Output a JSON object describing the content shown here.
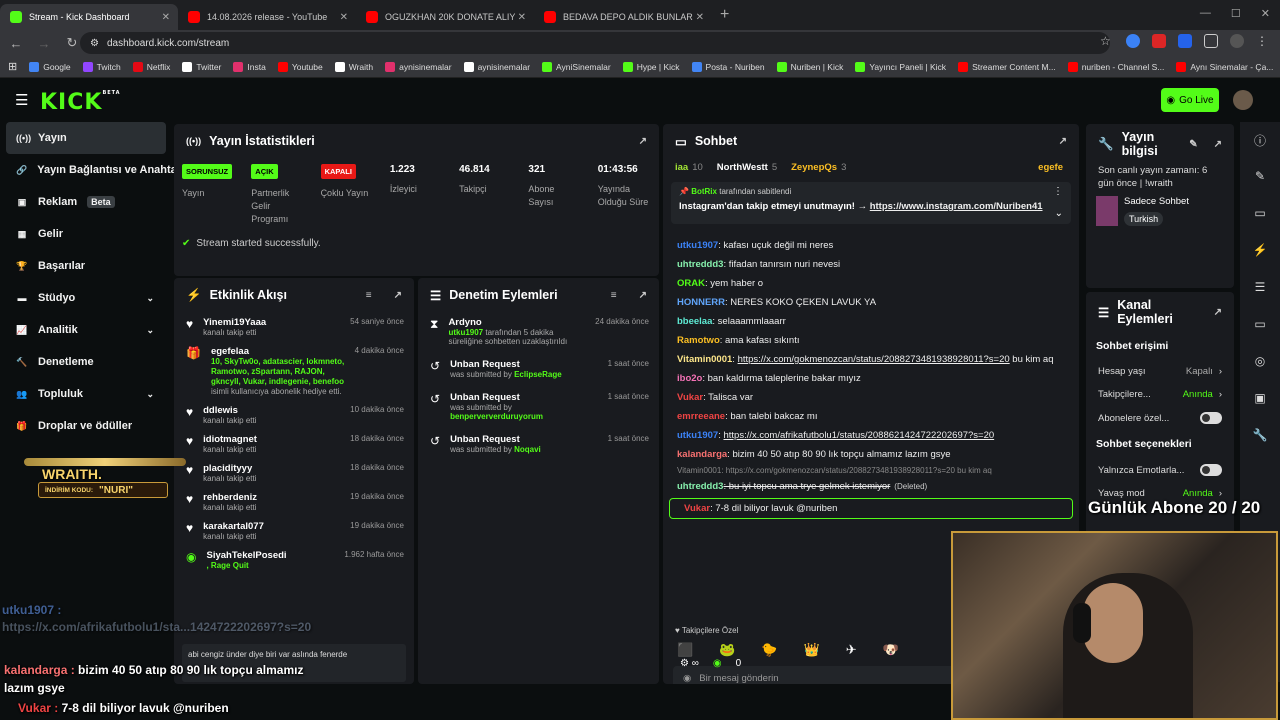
{
  "browser": {
    "tabs": [
      {
        "title": "Stream - Kick Dashboard",
        "color": "#53fc18",
        "active": true
      },
      {
        "title": "14.08.2026 release - YouTube",
        "color": "#ff0000"
      },
      {
        "title": "OGUZKHAN 20K DONATE ALIY",
        "color": "#ff0000"
      },
      {
        "title": "BEDAVA DEPO ALDIK BUNLAR",
        "color": "#ff0000"
      }
    ],
    "url": "dashboard.kick.com/stream",
    "bookmarks": [
      "Google",
      "Twitch",
      "Netflix",
      "Twitter",
      "Insta",
      "Youtube",
      "Wraith",
      "aynisinemalar",
      "aynisinemalar",
      "AyniSinemalar",
      "Hype | Kick",
      "Posta - Nuriben",
      "Nuriben | Kick",
      "Yayıncı Paneli | Kick",
      "Streamer Content M...",
      "nuriben - Channel S...",
      "Aynı Sinemalar - Ça..."
    ]
  },
  "kick": {
    "logo": "KICK",
    "logo_sup": "BETA",
    "golive": "Go Live",
    "sidebar": [
      {
        "label": "Yayın",
        "icon": "broadcast-icon",
        "glyph": "((•))",
        "active": true
      },
      {
        "label": "Yayın Bağlantısı ve Anahtarı",
        "icon": "link-icon",
        "glyph": "🔗"
      },
      {
        "label": "Reklam",
        "icon": "ad-icon",
        "glyph": "▣",
        "badge": "Beta"
      },
      {
        "label": "Gelir",
        "icon": "revenue-icon",
        "glyph": "▦"
      },
      {
        "label": "Başarılar",
        "icon": "trophy-icon",
        "glyph": "🏆"
      },
      {
        "label": "Stüdyo",
        "icon": "studio-icon",
        "glyph": "▬",
        "chev": true
      },
      {
        "label": "Analitik",
        "icon": "analytics-icon",
        "glyph": "📈",
        "chev": true
      },
      {
        "label": "Denetleme",
        "icon": "hammer-icon",
        "glyph": "🔨"
      },
      {
        "label": "Topluluk",
        "icon": "community-icon",
        "glyph": "👥",
        "chev": true
      },
      {
        "label": "Droplar ve ödüller",
        "icon": "gift-icon",
        "glyph": "🎁"
      }
    ],
    "stats": {
      "title": "Yayın İstatistikleri",
      "items": [
        {
          "pill": "SORUNSUZ",
          "pill_color": "#53fc18",
          "pill_text": "#000",
          "label": "Yayın"
        },
        {
          "pill": "AÇIK",
          "pill_color": "#53fc18",
          "pill_text": "#000",
          "label": "Partnerlik Gelir Programı"
        },
        {
          "pill": "KAPALI",
          "pill_color": "#e91916",
          "pill_text": "#fff",
          "label": "Çoklu Yayın"
        },
        {
          "value": "1.223",
          "label": "İzleyici"
        },
        {
          "value": "46.814",
          "label": "Takipçi"
        },
        {
          "value": "321",
          "label": "Abone Sayısı"
        },
        {
          "value": "01:43:56",
          "label": "Yayında Olduğu Süre"
        }
      ],
      "status": "Stream started successfully."
    },
    "activity": {
      "title": "Etkinlik Akışı",
      "items": [
        {
          "name": "Yinemi19Yaaa",
          "sub": "kanalı takip etti",
          "time": "54 saniye önce",
          "icon": "heart"
        },
        {
          "name": "egefelaa",
          "sub": "isimli kullanıcıya abonelik hediye etti.",
          "time": "4 dakika önce",
          "icon": "gift",
          "extra": "10, SkyTw0o, adatascier, lokmneto, Ramotwo, zSpartann, RAJON, gkncyll, Vukar, indlegenie, benefoo"
        },
        {
          "name": "ddlewis",
          "sub": "kanalı takip etti",
          "time": "10 dakika önce",
          "icon": "heart"
        },
        {
          "name": "idiotmagnet",
          "sub": "kanalı takip etti",
          "time": "18 dakika önce",
          "icon": "heart"
        },
        {
          "name": "placidityyy",
          "sub": "kanalı takip etti",
          "time": "18 dakika önce",
          "icon": "heart"
        },
        {
          "name": "rehberdeniz",
          "sub": "kanalı takip etti",
          "time": "19 dakika önce",
          "icon": "heart"
        },
        {
          "name": "karakartal077",
          "sub": "kanalı takip etti",
          "time": "19 dakika önce",
          "icon": "heart"
        },
        {
          "name": "SiyahTekelPosedi",
          "sub": ", Rage Quit",
          "time": "1.962 hafta önce",
          "icon": "kick"
        }
      ],
      "message": "abi cengiz ünder diye biri var aslında fenerde"
    },
    "moderation": {
      "title": "Denetim Eylemleri",
      "items": [
        {
          "name": "Ardyno",
          "time": "24 dakika önce",
          "by": "utku1907",
          "sub": " tarafından 5 dakika süreliğine sohbetten uzaklaştırıldı"
        },
        {
          "name": "Unban Request",
          "time": "1 saat önce",
          "sub": "was submitted by ",
          "by": "EclipseRage"
        },
        {
          "name": "Unban Request",
          "time": "1 saat önce",
          "sub": "was submitted by ",
          "by": "benperververduruyorum"
        },
        {
          "name": "Unban Request",
          "time": "1 saat önce",
          "sub": "was submitted by ",
          "by": "Noqavi"
        }
      ]
    },
    "chat": {
      "title": "Sohbet",
      "top_users": [
        {
          "name": "iaa",
          "n": "10"
        },
        {
          "name": "NorthWestt",
          "n": "5"
        },
        {
          "name": "ZeynepQs",
          "n": "3"
        },
        {
          "name": "egefe",
          "n": ""
        }
      ],
      "pinned_by": "BotRix",
      "pinned_sfx": "tarafından sabitlendi",
      "pinned_text": "Instagram'dan takip etmeyi unutmayın! →",
      "pinned_link": "https://www.instagram.com/Nuriben41",
      "messages": [
        {
          "user": "utku1907",
          "color": "#3b82f6",
          "text": ": kafası uçuk değil mi neres"
        },
        {
          "user": "uhtreddd3",
          "color": "#86efac",
          "text": ": fifadan tanırsın nuri nevesi"
        },
        {
          "user": "ORAK",
          "color": "#53fc18",
          "text": ": yem haber o"
        },
        {
          "user": "HONNERR",
          "color": "#60a5fa",
          "text": ": NERES KOKO ÇEKEN LAVUK YA"
        },
        {
          "user": "bbeelaa",
          "color": "#5eead4",
          "text": ": selaaammlaaarr"
        },
        {
          "user": "Ramotwo",
          "color": "#fbbf24",
          "text": ": ama kafası sıkıntı"
        },
        {
          "user": "Vitamin0001",
          "color": "#fde68a",
          "text": ": ",
          "link": "https://x.com/gokmenozcan/status/2088273481938928011?s=20",
          "after": " bu kim aq"
        },
        {
          "user": "ibo2o",
          "color": "#f472b6",
          "text": ": ban kaldırma taleplerine bakar mıyız"
        },
        {
          "user": "Vukar",
          "color": "#ef4444",
          "text": ": Talisca var"
        },
        {
          "user": "emrreeane",
          "color": "#ef4444",
          "text": ": ban talebi bakcaz mı"
        },
        {
          "user": "utku1907",
          "color": "#3b82f6",
          "text": ": ",
          "link": "https://x.com/afrikafutbolu1/status/2088621424722202697?s=20"
        },
        {
          "user": "kalandarga",
          "color": "#f87171",
          "text": ": bizim 40 50 atıp 80 90 lık topçu almamız lazım gsye"
        },
        {
          "user": "uhtreddd3",
          "color": "#86efac",
          "text": ": bu iyi topcu ama trye gelmek istemiyor",
          "deleted": "(Deleted)",
          "reply": "Vitamin0001: https://x.com/gokmenozcan/status/2088273481938928011?s=20 bu kim aq"
        },
        {
          "user": "Vukar",
          "color": "#ef4444",
          "text": ": 7-8 dil biliyor lavuk @nuriben"
        }
      ],
      "followers_only": "Takipçilere Özel",
      "input_placeholder": "Bir mesaj gönderin",
      "points": "0"
    },
    "info": {
      "title": "Yayın bilgisi",
      "last_live": "Son canlı yayın zamanı: 6 gün önce | !wraith",
      "category": "Sadece Sohbet",
      "tag": "Turkish"
    },
    "channel": {
      "title": "Kanal Eylemleri",
      "chat_access": "Sohbet erişimi",
      "rows": [
        {
          "label": "Hesap yaşı",
          "value": "Kapalı"
        },
        {
          "label": "Takipçilere...",
          "value": "Anında"
        },
        {
          "label": "Abonelere özel...",
          "value": ""
        }
      ],
      "chat_options": "Sohbet seçenekleri",
      "rows2": [
        {
          "label": "Yalnızca Emotlarla...",
          "value": ""
        },
        {
          "label": "Yavaş mod",
          "value": "Anında"
        }
      ]
    }
  },
  "stream_overlay": {
    "wraith_brand": "WRAITH.",
    "promo_label": "İNDİRİM KODU:",
    "promo_code": "\"NURI\"",
    "sub_goal": "Günlük Abone 20 / 20",
    "chat1_user": "utku1907 :",
    "chat1_text": "https://x.com/afrikafutbolu1/sta...1424722202697?s=20",
    "chat2_user": "kalandarga :",
    "chat2_text": "bizim 40 50 atıp 80 90 lık topçu almamız lazım gsye",
    "chat3_user": "Vukar :",
    "chat3_text": "7-8 dil biliyor lavuk @nuriben"
  }
}
